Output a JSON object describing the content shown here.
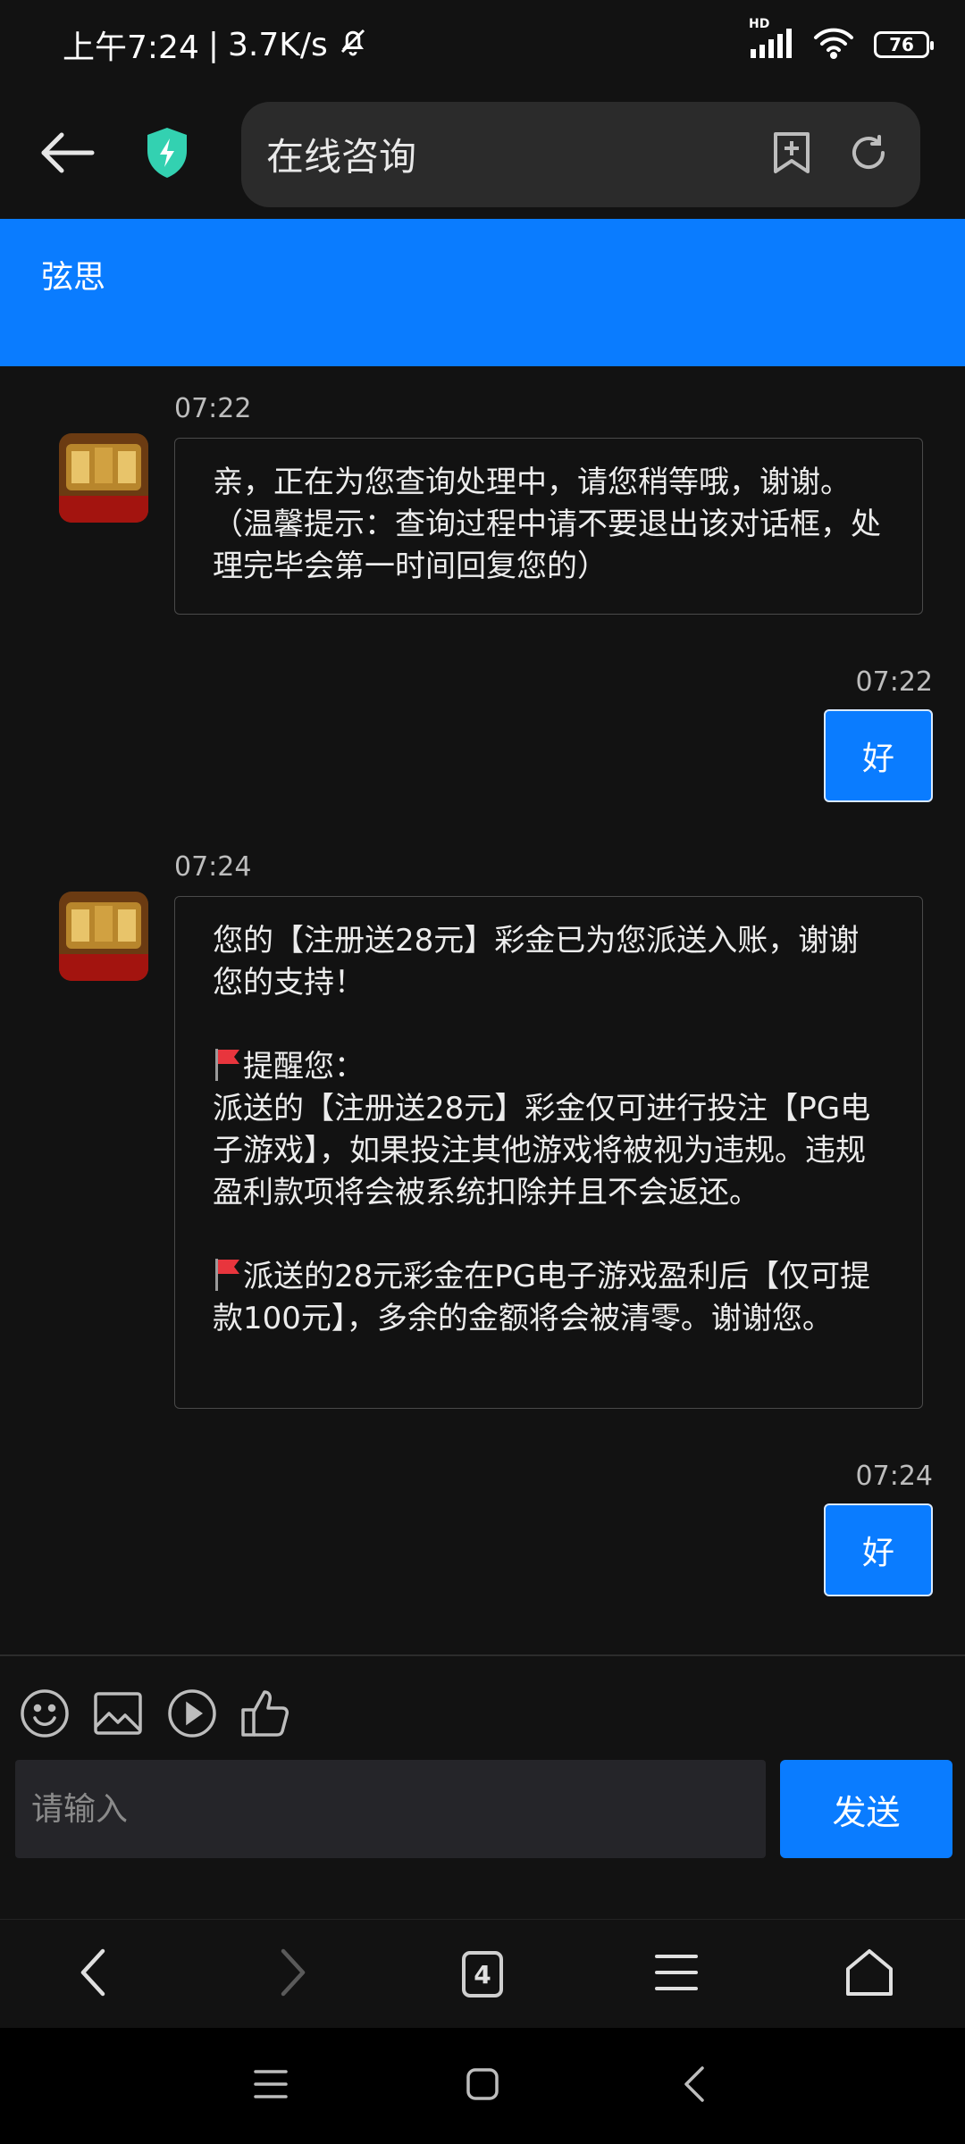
{
  "status_bar": {
    "time": "上午7:24",
    "speed": "3.7K/s",
    "network": "HD",
    "battery": "76"
  },
  "browser": {
    "page_title": "在线咨询"
  },
  "chat": {
    "agent_name": "弦思",
    "messages": [
      {
        "time": "07:22",
        "lines": [
          "亲，正在为您查询处理中，请您稍等哦，谢谢。（温馨提示：查询过程中请不要退出该对话框，处理完毕会第一时间回复您的）"
        ]
      },
      {
        "time": "07:22",
        "text": "好"
      },
      {
        "time": "07:24",
        "para1": "您的【注册送28元】彩金已为您派送入账，谢谢您的支持！",
        "para2_title": "提醒您：",
        "para2_body": "派送的【注册送28元】彩金仅可进行投注【PG电子游戏】，如果投注其他游戏将被视为违规。违规盈利款项将会被系统扣除并且不会返还。",
        "para3": "派送的28元彩金在PG电子游戏盈利后【仅可提款100元】，多余的金额将会被清零。谢谢您。"
      },
      {
        "time": "07:24",
        "text": "好"
      }
    ]
  },
  "composer": {
    "placeholder": "请输入",
    "send_label": "发送"
  },
  "bottom_nav": {
    "tab_count": "4"
  }
}
